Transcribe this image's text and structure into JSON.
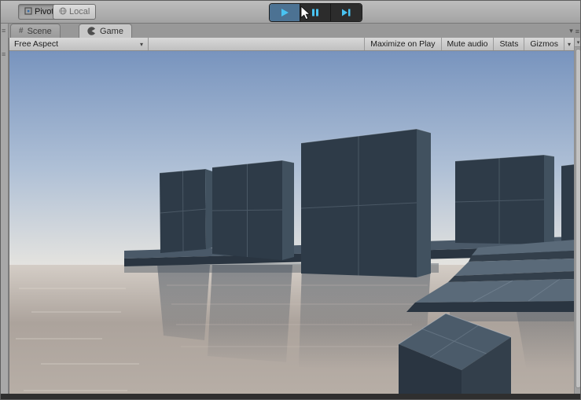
{
  "top_toolbar": {
    "pivot_label": "Pivot",
    "local_label": "Local"
  },
  "transport": {
    "play": "play",
    "pause": "pause",
    "step": "step",
    "state": "playing"
  },
  "tab_bar": {
    "tabs": [
      {
        "label": "Scene",
        "active": false
      },
      {
        "label": "Game",
        "active": true
      }
    ]
  },
  "game_toolbar": {
    "aspect_selected": "Free Aspect",
    "buttons": [
      "Maximize on Play",
      "Mute audio",
      "Stats",
      "Gizmos"
    ]
  },
  "icons": {
    "caret": "▾",
    "menu": "≡",
    "scene_grid": "#"
  },
  "colors": {
    "chrome": "#A8A8A8",
    "toolbar-top": "#BDBDBD",
    "toolbar-bottom": "#A3A3A3",
    "tab-strip": "#989898",
    "tab-active": "#C8C8C8",
    "tab-inactive-top": "#ACACAC",
    "tab-inactive-bottom": "#9B9B9B",
    "gametoolbar-top": "#D8D8D8",
    "gametoolbar-bottom": "#C0C0C0",
    "btn-dark": "#2C2C2C",
    "play-active": "#4C7293",
    "play-icon": "#49C3F2",
    "sky-top": "#7894BE",
    "sky-mid": "#AFC0D6",
    "sky-horizon": "#E4E3DF",
    "water-far": "#D4CDC6",
    "water-mid": "#ACA39C",
    "water-near": "#B7AEA6",
    "reflection": "#4E5863",
    "cube-front": "#2E3B48",
    "cube-side": "#41515F",
    "cube-top": "#4B5B6A",
    "platform-front": "#2A3541",
    "platform-top": "#4A5968",
    "step-front": "#333F4B",
    "step-top": "#5A6A79",
    "bottom-bar": "#2F2F2F"
  }
}
